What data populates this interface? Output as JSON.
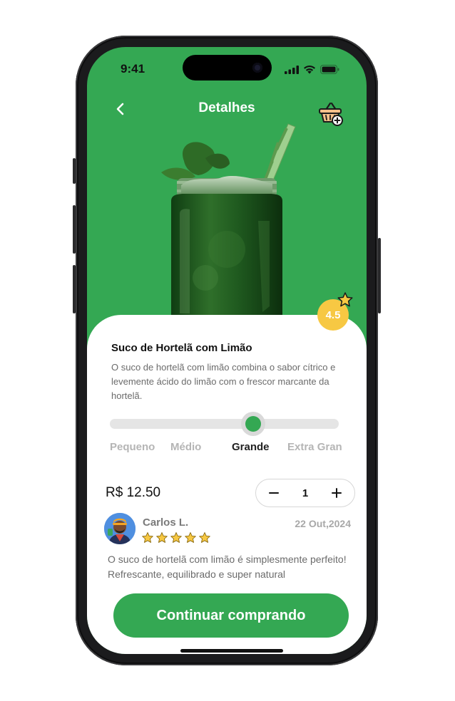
{
  "status_bar": {
    "time": "9:41"
  },
  "header": {
    "title": "Detalhes"
  },
  "product": {
    "rating": "4.5",
    "name": "Suco de Hortelã com Limão",
    "description": "O suco de hortelã com limão combina o sabor cítrico e levemente ácido do limão com o frescor marcante da hortelã."
  },
  "sizes": {
    "options": [
      "Pequeno",
      "Médio",
      "Grande",
      "Extra Gran"
    ],
    "selected": "Grande"
  },
  "order": {
    "price": "R$ 12.50",
    "quantity": "1"
  },
  "review": {
    "author": "Carlos L.",
    "date": "22 Out,2024",
    "stars": 5,
    "text": "O suco de hortelã com limão é simplesmente perfeito! Refrescante, equilibrado e super natural"
  },
  "cta": {
    "label": "Continuar comprando"
  },
  "colors": {
    "accent": "#34a853",
    "rating_badge": "#f7c843",
    "star": "#f7c843"
  }
}
